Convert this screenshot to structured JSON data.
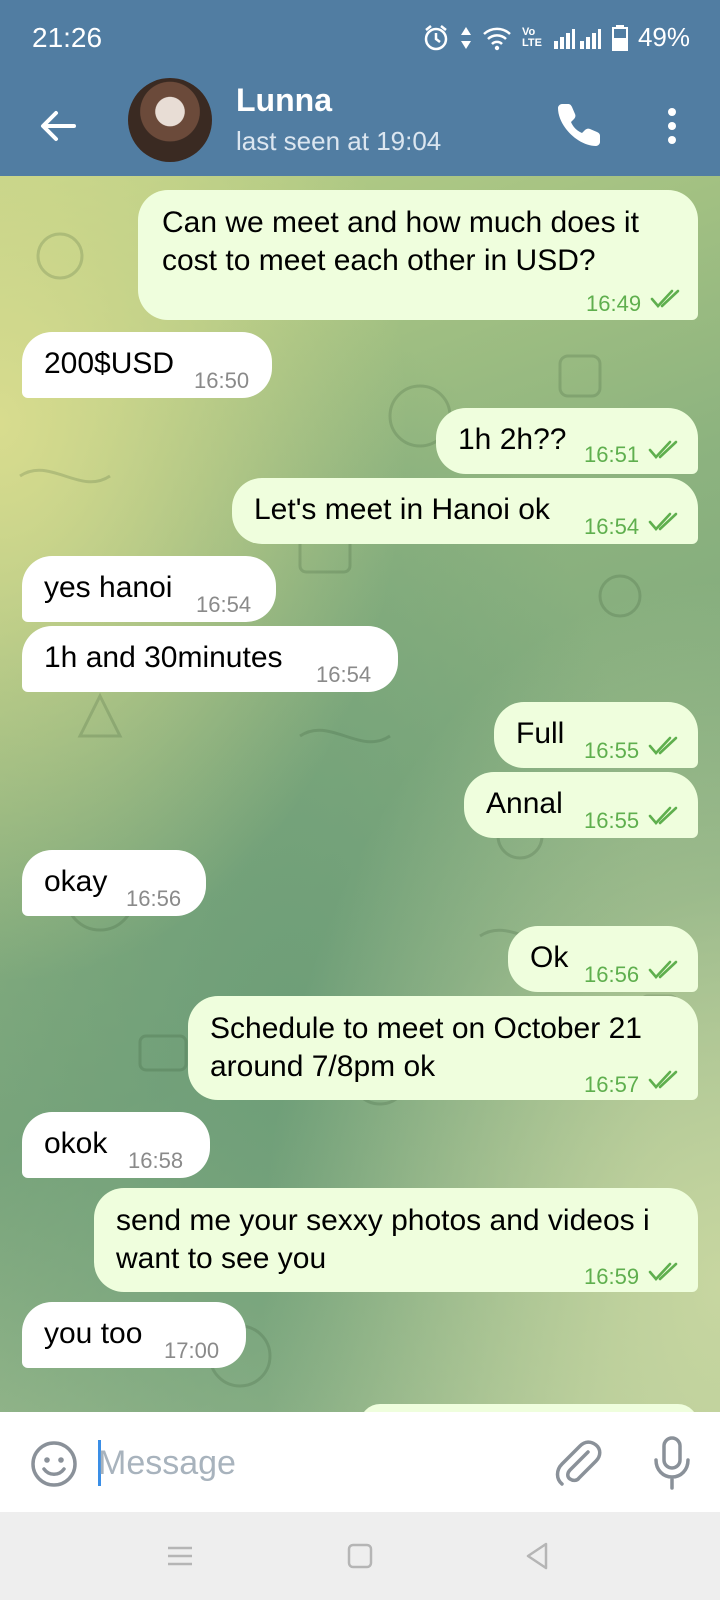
{
  "status": {
    "time": "21:26",
    "battery": "49%",
    "network": "Vo LTE"
  },
  "chat": {
    "contact_name": "Lunna",
    "last_seen": "last seen at 19:04"
  },
  "messages": [
    {
      "dir": "out",
      "text": "Can we meet and how much does it cost to meet each other in USD?",
      "time": "16:49"
    },
    {
      "dir": "in",
      "text": "200$USD",
      "time": "16:50"
    },
    {
      "dir": "out",
      "text": "1h 2h??",
      "time": "16:51"
    },
    {
      "dir": "out",
      "text": "Let's meet in Hanoi ok",
      "time": "16:54"
    },
    {
      "dir": "in",
      "text": "yes hanoi",
      "time": "16:54"
    },
    {
      "dir": "in",
      "text": "1h and 30minutes",
      "time": "16:54"
    },
    {
      "dir": "out",
      "text": "Full",
      "time": "16:55"
    },
    {
      "dir": "out",
      "text": "Annal",
      "time": "16:55"
    },
    {
      "dir": "in",
      "text": "okay",
      "time": "16:56"
    },
    {
      "dir": "out",
      "text": "Ok",
      "time": "16:56"
    },
    {
      "dir": "out",
      "text": "Schedule to meet on October 21 around 7/8pm ok",
      "time": "16:57"
    },
    {
      "dir": "in",
      "text": "okok",
      "time": "16:58"
    },
    {
      "dir": "out",
      "text": "send me your sexxy photos and videos i want to see you",
      "time": "16:59"
    },
    {
      "dir": "in",
      "text": "you too",
      "time": "17:00"
    }
  ],
  "composer": {
    "placeholder": "Message"
  },
  "colors": {
    "header": "#517da2",
    "outgoing_bubble": "#effedd",
    "incoming_bubble": "#ffffff",
    "read_ticks": "#5faf4e"
  },
  "icons": [
    "back-arrow-icon",
    "phone-icon",
    "more-vert-icon",
    "emoji-icon",
    "attach-icon",
    "mic-icon",
    "alarm-icon",
    "wifi-icon",
    "signal-icon",
    "battery-icon"
  ]
}
